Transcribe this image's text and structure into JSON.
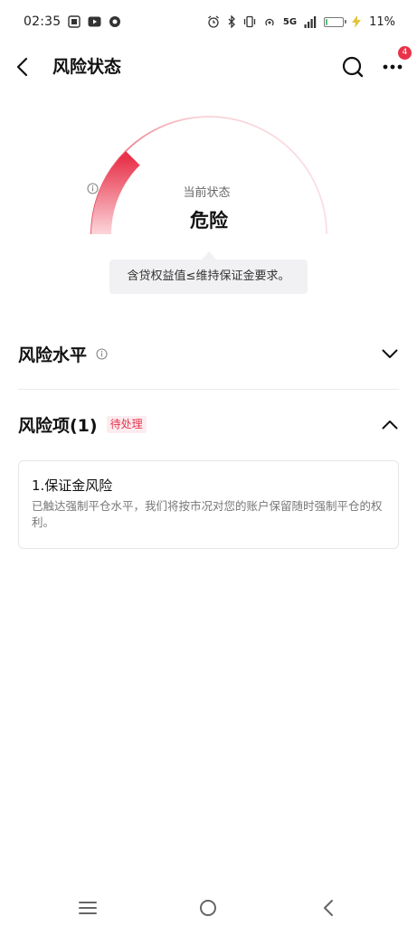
{
  "status_bar": {
    "time": "02:35",
    "network": "5G",
    "battery_text": "11%",
    "battery_level": 0.11,
    "icons": [
      "gallery-icon",
      "video-icon",
      "app-icon",
      "alarm-icon",
      "bluetooth-icon",
      "vibrate-icon",
      "hotspot-icon",
      "signal-icon",
      "battery-icon",
      "charging-icon"
    ]
  },
  "header": {
    "title": "风险状态",
    "more_badge": "4"
  },
  "gauge": {
    "label": "当前状态",
    "value": "危险",
    "level": 0.25,
    "accent_color": "#e8334a",
    "tooltip": "含贷权益值≤维持保证金要求。"
  },
  "sections": {
    "risk_level": {
      "title": "风险水平",
      "expanded": false
    },
    "risk_items": {
      "title": "风险项(1)",
      "badge": "待处理",
      "expanded": true,
      "items": [
        {
          "title": "1.保证金风险",
          "description": "已触达强制平仓水平，我们将按市况对您的账户保留随时强制平仓的权利。"
        }
      ]
    }
  },
  "colors": {
    "accent": "#e8334a",
    "badge_bg": "#fdecef",
    "tooltip_bg": "#f1f1f3"
  }
}
